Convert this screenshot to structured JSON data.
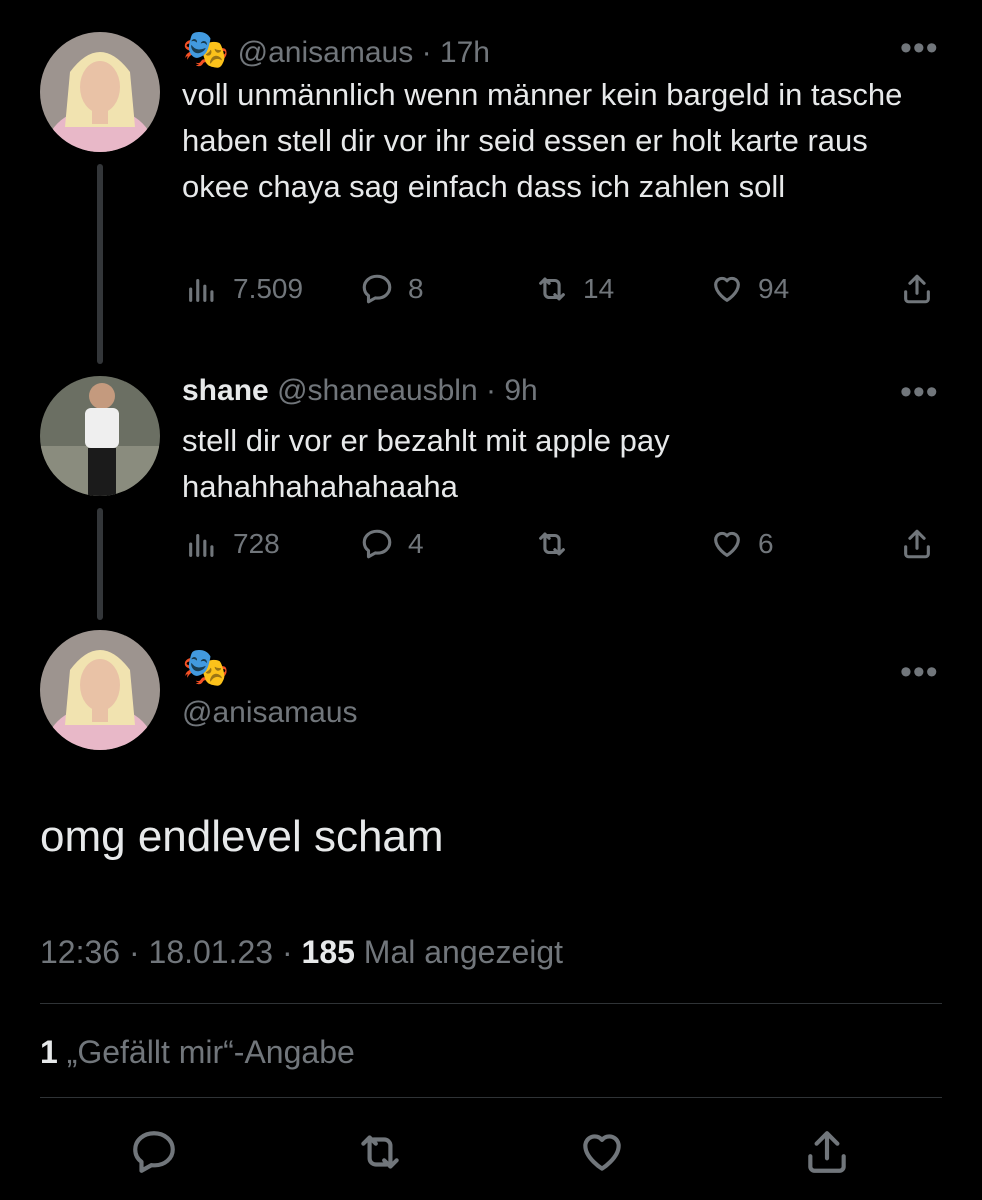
{
  "colors": {
    "background": "#000000",
    "text": "#e7e9ea",
    "muted": "#71767b",
    "divider": "#2f3336"
  },
  "tweet1": {
    "emoji": "🎭",
    "handle": "@anisamaus",
    "time": "· 17h",
    "text": "voll unmännlich wenn männer kein bargeld in tasche haben stell dir vor ihr seid essen er holt karte raus okee chaya sag einfach dass ich zahlen soll",
    "views": "7.509",
    "replies": "8",
    "retweets": "14",
    "likes": "94",
    "more": "•••"
  },
  "tweet2": {
    "name": "shane",
    "handle": "@shaneausbln",
    "time": "· 9h",
    "text": "stell dir vor er bezahlt mit apple pay hahahhahahahaaha",
    "views": "728",
    "replies": "4",
    "likes": "6",
    "more": "•••"
  },
  "main": {
    "emoji": "🎭",
    "handle": "@anisamaus",
    "text": "omg endlevel scham",
    "time": "12:36",
    "date": "· 18.01.23 ·",
    "views_count": "185",
    "views_label": "Mal angezeigt",
    "likes_count": "1",
    "likes_label": "„Gefällt mir“-Angabe",
    "more": "•••"
  },
  "icons": [
    "views-icon",
    "reply-icon",
    "retweet-icon",
    "like-icon",
    "share-icon",
    "more-icon"
  ]
}
